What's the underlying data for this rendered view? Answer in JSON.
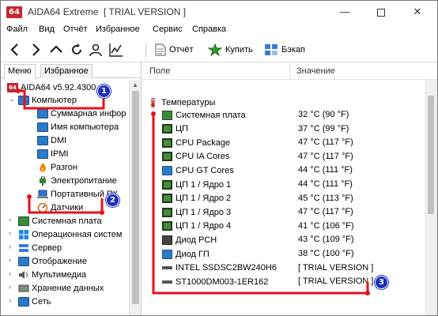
{
  "window": {
    "logo": "64",
    "title": "AIDA64 Extreme  [ TRIAL VERSION ]",
    "min": "—",
    "close": "✕"
  },
  "menubar": {
    "items": [
      "Файл",
      "Вид",
      "Отчёт",
      "Избранное",
      "Сервис",
      "Справка"
    ]
  },
  "toolbar": {
    "report_label": "Отчёт",
    "buy_label": "Купить",
    "backup_label": "Бэкап"
  },
  "tabs": {
    "menu": "Меню",
    "favorites": "Избранное"
  },
  "tree": {
    "root": "AIDA64 v5.92.4300",
    "computer": "Компьютер",
    "children": [
      "Суммарная инфор",
      "Имя компьютера",
      "DMI",
      "IPMI",
      "Разгон",
      "Электропитание",
      "Портативный ПК",
      "Датчики"
    ],
    "siblings": [
      "Системная плата",
      "Операционная систем",
      "Сервер",
      "Отображение",
      "Мультимедиа",
      "Хранение данных",
      "Сеть"
    ]
  },
  "columns": {
    "field": "Поле",
    "value": "Значение"
  },
  "section": "Температуры",
  "rows": [
    {
      "field": "Системная плата",
      "value": "32 °C  (90 °F)"
    },
    {
      "field": "ЦП",
      "value": "37 °C  (99 °F)"
    },
    {
      "field": "CPU Package",
      "value": "47 °C  (117 °F)"
    },
    {
      "field": "CPU IA Cores",
      "value": "47 °C  (117 °F)"
    },
    {
      "field": "CPU GT Cores",
      "value": "44 °C  (111 °F)"
    },
    {
      "field": "ЦП 1 / Ядро 1",
      "value": "44 °C  (111 °F)"
    },
    {
      "field": "ЦП 1 / Ядро 2",
      "value": "45 °C  (113 °F)"
    },
    {
      "field": "ЦП 1 / Ядро 3",
      "value": "47 °C  (117 °F)"
    },
    {
      "field": "ЦП 1 / Ядро 4",
      "value": "41 °C  (106 °F)"
    },
    {
      "field": "Диод PCH",
      "value": "43 °C  (109 °F)"
    },
    {
      "field": "Диод ГП",
      "value": "38 °C  (100 °F)"
    },
    {
      "field": "INTEL SSDSC2BW240H6",
      "value": "[ TRIAL VERSION ]"
    },
    {
      "field": "ST1000DM003-1ER162",
      "value": "[ TRIAL VERSION ]"
    }
  ],
  "annotations": {
    "badge1": "1",
    "badge2": "2",
    "badge3": "3"
  },
  "colors": {
    "accent_red": "#e8101a",
    "badge_blue": "#1a2fbd"
  }
}
